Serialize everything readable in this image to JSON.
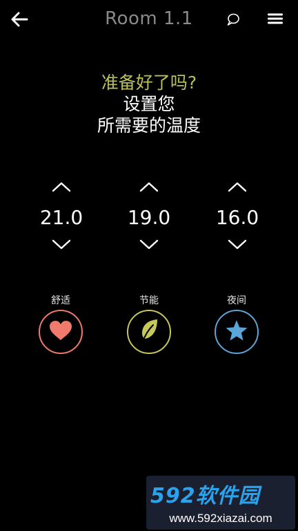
{
  "header": {
    "title": "Room 1.1",
    "back_icon": "arrow-left-icon",
    "chat_icon": "chat-bubble-icon",
    "menu_icon": "hamburger-menu-icon"
  },
  "heading": {
    "line1": "准备好了吗?",
    "line2": "设置您",
    "line3": "所需要的温度",
    "line1_color": "#b9c05a"
  },
  "temperatures": [
    {
      "value": "21.0"
    },
    {
      "value": "19.0"
    },
    {
      "value": "16.0"
    }
  ],
  "modes": [
    {
      "label": "舒适",
      "icon": "heart-icon",
      "color": "#f07b6c"
    },
    {
      "label": "节能",
      "icon": "leaf-icon",
      "color": "#c6c85a"
    },
    {
      "label": "夜间",
      "icon": "star-icon",
      "color": "#5ba6d8"
    }
  ],
  "watermark": {
    "brand": "592软件园",
    "url": "www.592xiazai.com"
  }
}
